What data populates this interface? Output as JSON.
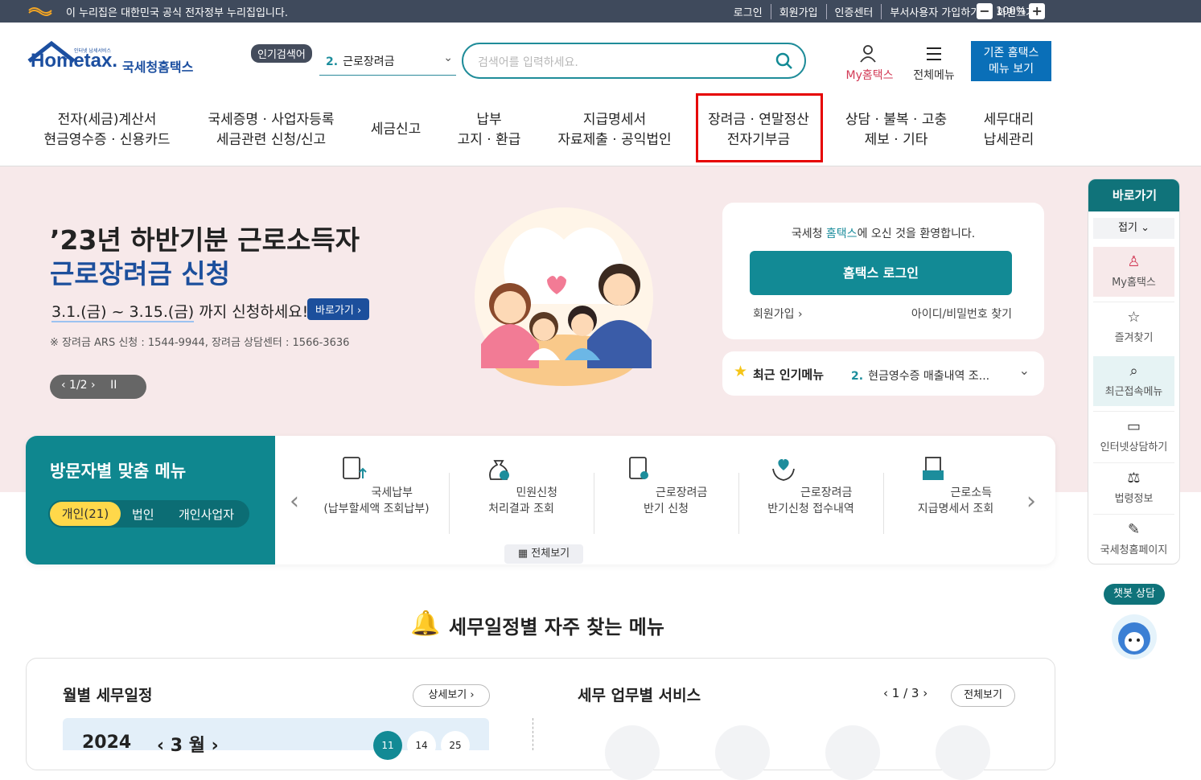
{
  "topbar": {
    "gov_notice": "이 누리집은 대한민국 공식 전자정부 누리집입니다.",
    "links": [
      "로그인",
      "회원가입",
      "인증센터",
      "부서사용자 가입하기",
      "화면크기"
    ],
    "zoom": "100%"
  },
  "header": {
    "logo_text": "Hometax.",
    "logo_small": "인터넷 납세서비스",
    "logo_kr": "국세청홈택스",
    "popular_badge": "인기검색어",
    "popular_rank": "2.",
    "popular_keyword": "근로장려금",
    "search_placeholder": "검색어를 입력하세요.",
    "my_hometax": "My홈택스",
    "all_menu": "전체메뉴",
    "old_menu_line1": "기존 홈택스",
    "old_menu_line2": "메뉴 보기"
  },
  "nav": [
    {
      "l1": "전자(세금)계산서",
      "l2": "현금영수증 · 신용카드"
    },
    {
      "l1": "국세증명 · 사업자등록",
      "l2": "세금관련 신청/신고"
    },
    {
      "l1": "세금신고",
      "l2": ""
    },
    {
      "l1": "납부",
      "l2": "고지 · 환급"
    },
    {
      "l1": "지급명세서",
      "l2": "자료제출 · 공익법인"
    },
    {
      "l1": "장려금 · 연말정산",
      "l2": "전자기부금"
    },
    {
      "l1": "상담 · 불복 · 고충",
      "l2": "제보 · 기타"
    },
    {
      "l1": "세무대리",
      "l2": "납세관리"
    }
  ],
  "hero": {
    "line1": "’23년 하반기분 근로소득자",
    "line2": "근로장려금 신청",
    "period": "3.1.(금) ~ 3.15.(금)",
    "period_suffix": " 까지 신청하세요!",
    "go_button": "바로가기 ›",
    "note": "※ 장려금 ARS 신청 : 1544-9944, 장려금 상담센터 : 1566-3636",
    "pager": "‹ 1/2 ›",
    "pause": "II"
  },
  "login": {
    "welcome_pre": "국세청 ",
    "welcome_brand": "홈택스",
    "welcome_post": "에 오신 것을 환영합니다.",
    "login_button": "홈택스 로그인",
    "join": "회원가입 ›",
    "find": "아이디/비밀번호 찾기"
  },
  "popular_menu": {
    "title": "최근 인기메뉴",
    "rank": "2.",
    "item": "현금영수증 매출내역 조...",
    "chevron": "⌄"
  },
  "visitor": {
    "title": "방문자별 맞춤 메뉴",
    "tabs": [
      "개인(21)",
      "법인",
      "개인사업자"
    ],
    "items": [
      {
        "l1": "국세납부",
        "l2": "(납부할세액 조회납부)"
      },
      {
        "l1": "민원신청",
        "l2": "처리결과 조회"
      },
      {
        "l1": "근로장려금",
        "l2": "반기 신청"
      },
      {
        "l1": "근로장려금",
        "l2": "반기신청 접수내역"
      },
      {
        "l1": "근로소득",
        "l2": "지급명세서 조회"
      }
    ],
    "all_view": "전체보기"
  },
  "sidebar": {
    "title": "바로가기",
    "fold": "접기 ⌄",
    "items": [
      "My홈택스",
      "즐겨찾기",
      "최근접속메뉴",
      "인터넷상담하기",
      "법령정보",
      "국세청홈페이지"
    ],
    "chatbot": "챗봇 상담"
  },
  "schedule": {
    "title": "세무일정별 자주 찾는 메뉴",
    "monthly": "월별 세무일정",
    "detail": "상세보기 ›",
    "year": "2024",
    "month": "‹ 3 월 ›",
    "days": [
      "11",
      "14",
      "25"
    ],
    "service": "세무 업무별 서비스",
    "service_page": "‹ 1 / 3 ›",
    "service_all": "전체보기"
  }
}
